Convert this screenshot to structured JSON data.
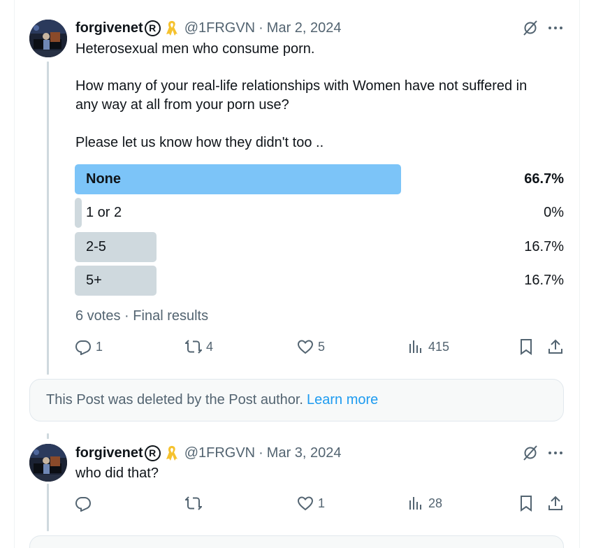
{
  "posts": [
    {
      "name": "forgivenet",
      "reg_mark": "R",
      "handle": "@1FRGVN",
      "separator": "·",
      "date": "Mar 2, 2024",
      "lines": [
        "Heterosexual men who consume porn.",
        "How many of your real-life relationships with Women have not suffered in",
        "any way at all from your porn use?",
        "Please let us know how they didn't too .."
      ],
      "poll": {
        "options": [
          {
            "label": "None",
            "percent_text": "66.7%",
            "fraction": 0.667,
            "winner": true
          },
          {
            "label": "1 or 2",
            "percent_text": "0%",
            "fraction": 0.0,
            "winner": false
          },
          {
            "label": "2-5",
            "percent_text": "16.7%",
            "fraction": 0.167,
            "winner": false
          },
          {
            "label": "5+",
            "percent_text": "16.7%",
            "fraction": 0.167,
            "winner": false
          }
        ],
        "votes": "6 votes",
        "status": "Final results"
      },
      "actions": {
        "replies": "1",
        "reposts": "4",
        "likes": "5",
        "views": "415"
      }
    },
    {
      "name": "forgivenet",
      "reg_mark": "R",
      "handle": "@1FRGVN",
      "separator": "·",
      "date": "Mar 3, 2024",
      "lines": [
        "who did that?"
      ],
      "actions": {
        "replies": "",
        "reposts": "",
        "likes": "1",
        "views": "28"
      }
    }
  ],
  "deleted_notice": {
    "text": "This Post was deleted by the Post author.",
    "link": "Learn more"
  },
  "icons": {
    "reply": "reply-icon",
    "repost": "repost-icon",
    "like": "heart-icon",
    "views": "views-icon",
    "bookmark": "bookmark-icon",
    "share": "share-icon",
    "grok": "grok-icon",
    "more": "more-icon",
    "ribbon": "yellow-ribbon-icon"
  },
  "colors": {
    "poll_winner": "#7cc4f8",
    "poll_other": "#cfd9de",
    "link": "#1d9bf0",
    "secondary_text": "#536471",
    "ribbon": "#f5c22e"
  }
}
